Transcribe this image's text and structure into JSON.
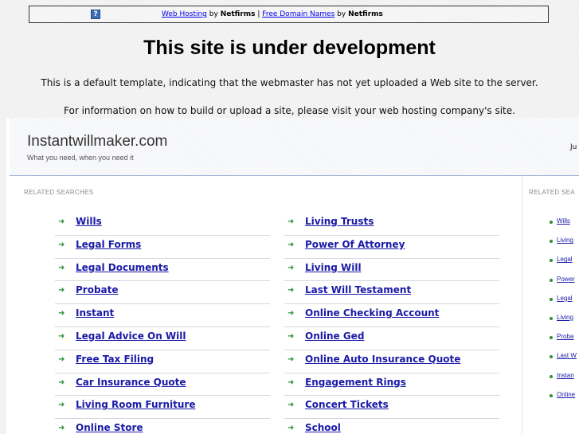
{
  "notice_bar": {
    "icon": "question-icon",
    "icon_glyph": "?",
    "link1": "Web Hosting",
    "by1": "by",
    "brand1": "Netfirms",
    "separator": "|",
    "link2": "Free Domain Names",
    "by2": "by",
    "brand2": "Netfirms"
  },
  "headline": "This site is under development",
  "message1": "This is a default template, indicating that the webmaster has not yet uploaded a Web site to the server.",
  "message2": "For information on how to build or upload a site, please visit your web hosting company's site.",
  "site": {
    "title": "Instantwillmaker.com",
    "tagline": "What you need, when you need it",
    "date_fragment": "Ju"
  },
  "main": {
    "section_label": "RELATED SEARCHES",
    "column_a": [
      "Wills",
      "Legal Forms",
      "Legal Documents",
      "Probate",
      "Instant",
      "Legal Advice On Will",
      "Free Tax Filing",
      "Car Insurance Quote",
      "Living Room Furniture",
      "Online Store"
    ],
    "column_b": [
      "Living Trusts",
      "Power Of Attorney",
      "Living Will",
      "Last Will Testament",
      "Online Checking Account",
      "Online Ged",
      "Online Auto Insurance Quote",
      "Engagement Rings",
      "Concert Tickets",
      "School"
    ]
  },
  "sidebar": {
    "section_label": "RELATED SEA",
    "items": [
      "Wills",
      "Living",
      "Legal",
      "Power",
      "Legal",
      "Living",
      "Proba",
      "Last W",
      "Instan",
      "Online"
    ]
  },
  "colors": {
    "link": "#1a1aa8",
    "arrow": "#2f8f3a",
    "header_border": "#9fb4d2"
  }
}
